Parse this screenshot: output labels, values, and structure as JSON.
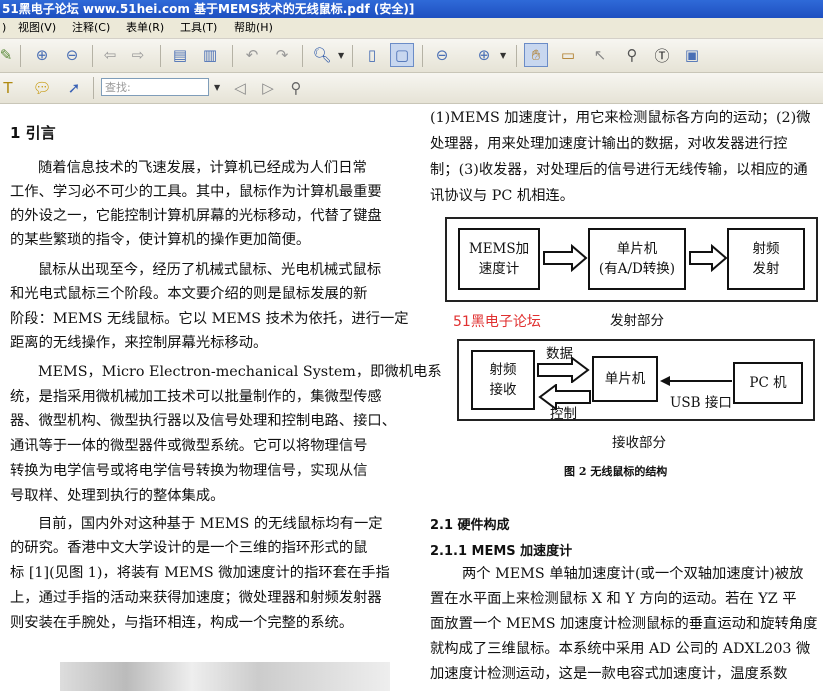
{
  "window": {
    "title": "51黑电子论坛 www.51hei.com 基于MEMS技术的无线鼠标.pdf (安全)]"
  },
  "menu": [
    ")",
    "视图(V)",
    "注释(C)",
    "表单(R)",
    "工具(T)",
    "帮助(H)"
  ],
  "toolbar": {
    "search_placeholder": "查找:"
  },
  "left_column": {
    "heading": "1 引言",
    "lines": [
      "随着信息技术的飞速发展，计算机已经成为人们日常",
      "工作、学习必不可少的工具。其中，鼠标作为计算机最重要",
      "的外设之一，它能控制计算机屏幕的光标移动，代替了键盘",
      "的某些繁琐的指令，使计算机的操作更加简便。",
      "鼠标从出现至今，经历了机械式鼠标、光电机械式鼠标",
      "和光电式鼠标三个阶段。本文要介绍的则是鼠标发展的新",
      "阶段：MEMS 无线鼠标。它以 MEMS 技术为依托，进行一定",
      "距离的无线操作，来控制屏幕光标移动。",
      "MEMS，Micro Electron-mechanical System，即微机电系",
      "统，是指采用微机械加工技术可以批量制作的，集微型传感",
      "器、微型机构、微型执行器以及信号处理和控制电路、接口、",
      "通讯等于一体的微型器件或微型系统。它可以将物理信号",
      "转换为电学信号或将电学信号转换为物理信号，实现从信",
      "号取样、处理到执行的整体集成。",
      "目前，国内外对这种基于 MEMS 的无线鼠标均有一定",
      "的研究。香港中文大学设计的是一个三维的指环形式的鼠",
      "标 [1](见图 1)，将装有 MEMS 微加速度计的指环套在手指",
      "上，通过手指的活动来获得加速度；微处理器和射频发射器",
      "则安装在手腕处，与指环相连，构成一个完整的系统。"
    ]
  },
  "right_column": {
    "intro_lines": [
      "(1)MEMS 加速度计，用它来检测鼠标各方向的运动；(2)微",
      "处理器，用来处理加速度计输出的数据，对收发器进行控",
      "制；(3)收发器，对处理后的信号进行无线传输，以相应的通",
      "讯协议与 PC 机相连。"
    ],
    "diagram": {
      "tx_box1": "MEMS加\n速度计",
      "tx_box2": "单片机\n(有A/D转换)",
      "tx_box3": "射频\n发射",
      "tx_label": "发射部分",
      "watermark": "51黑电子论坛",
      "rx_box1": "射频\n接收",
      "rx_box2": "单片机",
      "rx_box3": "PC 机",
      "rx_data": "数据",
      "rx_control": "控制",
      "rx_usb": "USB 接口",
      "rx_label": "接收部分",
      "caption": "图 2 无线鼠标的结构"
    },
    "h2": "2.1 硬件构成",
    "h3": "2.1.1 MEMS 加速度计",
    "body_lines": [
      "两个 MEMS 单轴加速度计(或一个双轴加速度计)被放",
      "置在水平面上来检测鼠标 X 和 Y 方向的运动。若在 YZ 平",
      "面放置一个 MEMS 加速度计检测鼠标的垂直运动和旋转角度",
      "就构成了三维鼠标。本系统中采用 AD 公司的 ADXL203 微",
      "加速度计检测运动，这是一款电容式加速度计，温度系数"
    ]
  }
}
